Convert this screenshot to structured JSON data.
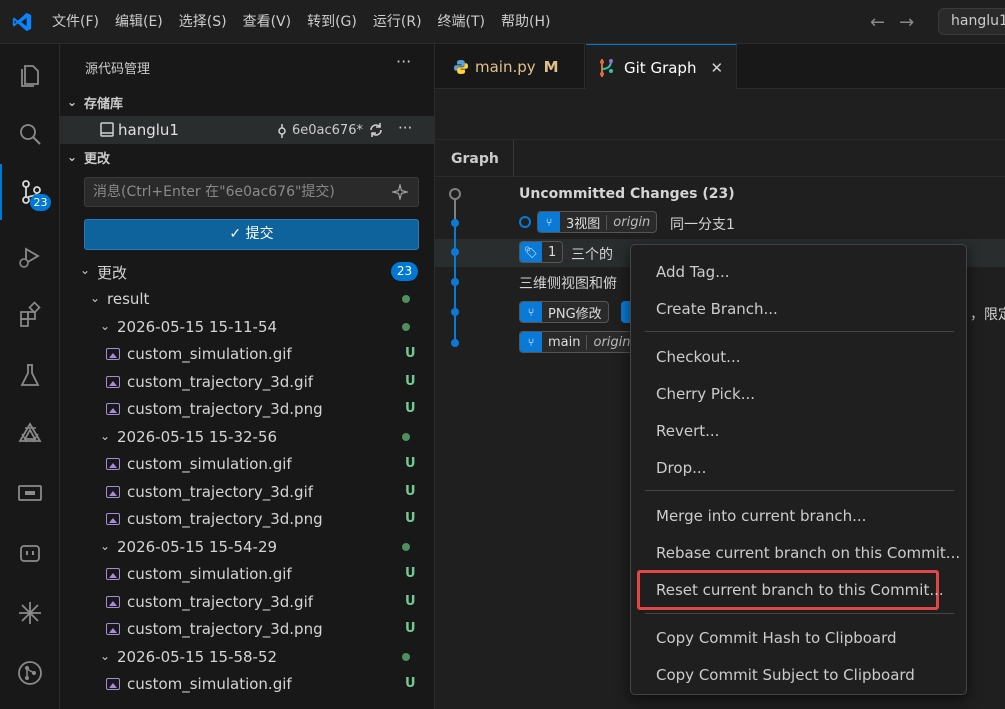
{
  "titlebar": {
    "menus": [
      "文件(F)",
      "编辑(E)",
      "选择(S)",
      "查看(V)",
      "转到(G)",
      "运行(R)",
      "终端(T)",
      "帮助(H)"
    ],
    "search_text": "hanglu1"
  },
  "activity": {
    "scm_badge": "23"
  },
  "sidebar": {
    "title": "源代码管理",
    "repos_label": "存储库",
    "repo_name": "hanglu1",
    "repo_hash": "6e0ac676*",
    "changes_section": "更改",
    "message_placeholder": "消息(Ctrl+Enter 在\"6e0ac676\"提交)",
    "commit_label": "提交",
    "changes_group": "更改",
    "changes_count": "23",
    "tree": [
      {
        "label": "result",
        "type": "folder",
        "indent": 1,
        "status": "dot"
      },
      {
        "label": "2026-05-15 15-11-54",
        "type": "folder",
        "indent": 2,
        "status": "dot"
      },
      {
        "label": "custom_simulation.gif",
        "type": "file",
        "status": "U"
      },
      {
        "label": "custom_trajectory_3d.gif",
        "type": "file",
        "status": "U"
      },
      {
        "label": "custom_trajectory_3d.png",
        "type": "file",
        "status": "U"
      },
      {
        "label": "2026-05-15 15-32-56",
        "type": "folder",
        "indent": 2,
        "status": "dot"
      },
      {
        "label": "custom_simulation.gif",
        "type": "file",
        "status": "U"
      },
      {
        "label": "custom_trajectory_3d.gif",
        "type": "file",
        "status": "U"
      },
      {
        "label": "custom_trajectory_3d.png",
        "type": "file",
        "status": "U"
      },
      {
        "label": "2026-05-15 15-54-29",
        "type": "folder",
        "indent": 2,
        "status": "dot"
      },
      {
        "label": "custom_simulation.gif",
        "type": "file",
        "status": "U"
      },
      {
        "label": "custom_trajectory_3d.gif",
        "type": "file",
        "status": "U"
      },
      {
        "label": "custom_trajectory_3d.png",
        "type": "file",
        "status": "U"
      },
      {
        "label": "2026-05-15 15-58-52",
        "type": "folder",
        "indent": 2,
        "status": "dot"
      },
      {
        "label": "custom_simulation.gif",
        "type": "file",
        "status": "U"
      }
    ]
  },
  "tabs": {
    "tab1_label": "main.py",
    "tab1_status": "M",
    "tab2_label": "Git Graph"
  },
  "graph": {
    "column_header": "Graph",
    "uncommitted": "Uncommitted Changes (23)",
    "commit1_ref": "3视图",
    "commit1_remote": "origin",
    "commit1_msg": "同一分支1",
    "commit2_tag": "1",
    "commit2_msg": "三个的",
    "commit3_msg": "三维侧视图和俯",
    "commit4_ref": "PNG修改",
    "commit4_tail": "，限定",
    "commit5_ref": "main",
    "commit5_remote": "origin"
  },
  "context_menu": {
    "items": [
      "Add Tag...",
      "Create Branch...",
      "Checkout...",
      "Cherry Pick...",
      "Revert...",
      "Drop...",
      "Merge into current branch...",
      "Rebase current branch on this Commit...",
      "Reset current branch to this Commit...",
      "Copy Commit Hash to Clipboard",
      "Copy Commit Subject to Clipboard"
    ],
    "highlighted_index": 8
  },
  "colors": {
    "accent": "#0078d4",
    "untracked": "#73c991",
    "modified": "#e2c08d",
    "highlight_box": "#e04848"
  }
}
